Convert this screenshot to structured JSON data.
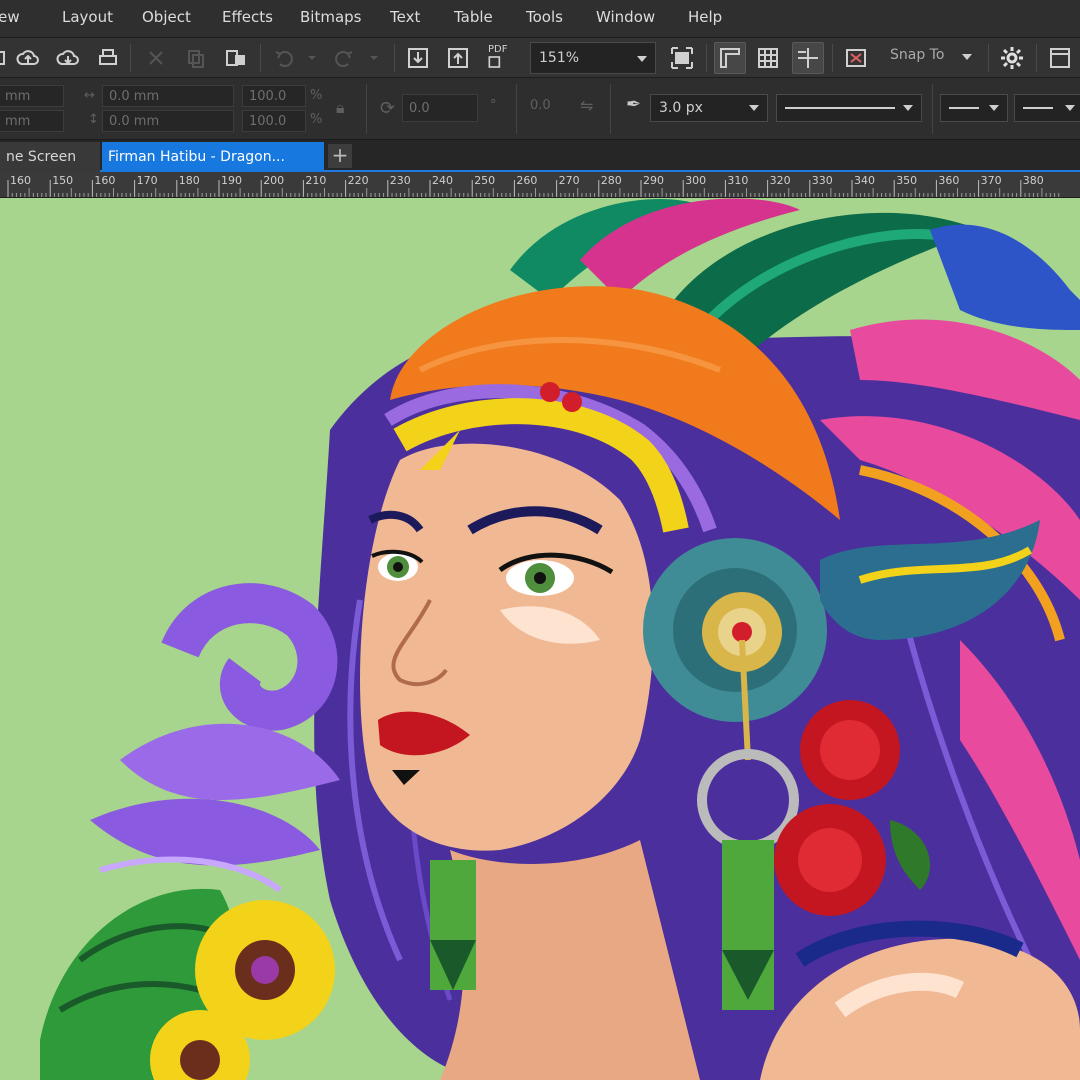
{
  "menu": {
    "items": [
      {
        "label": "View",
        "display": "View"
      },
      {
        "label": "Layout"
      },
      {
        "label": "Object"
      },
      {
        "label": "Effects"
      },
      {
        "label": "Bitmaps"
      },
      {
        "label": "Text"
      },
      {
        "label": "Table"
      },
      {
        "label": "Tools"
      },
      {
        "label": "Window"
      },
      {
        "label": "Help"
      }
    ]
  },
  "toolbar": {
    "zoom_value": "151%",
    "pdf_label": "PDF",
    "snap_to_label": "Snap To"
  },
  "property_bar": {
    "x_unit": "mm",
    "y_unit": "mm",
    "width_value": "0.0 mm",
    "height_value": "0.0 mm",
    "scale_w": "100.0",
    "scale_h": "100.0",
    "percent": "%",
    "angle_value": "0.0",
    "nudge_value": "0.0",
    "outline_width": "3.0 px"
  },
  "tabs": {
    "welcome_label": "Welcome Screen",
    "welcome_display": "ne Screen",
    "document_label": "Firman Hatibu - Dragon..."
  },
  "ruler": {
    "labels": [
      "160",
      "150",
      "160",
      "170",
      "180",
      "190",
      "200",
      "210",
      "220",
      "230",
      "240",
      "250",
      "260",
      "270",
      "280",
      "290",
      "300",
      "310",
      "320",
      "330",
      "340",
      "350",
      "360",
      "370",
      "380"
    ]
  },
  "colors": {
    "canvas_bg": "#a8d58d",
    "tab_active": "#1778e0",
    "ui_dark": "#2f2f2f"
  }
}
